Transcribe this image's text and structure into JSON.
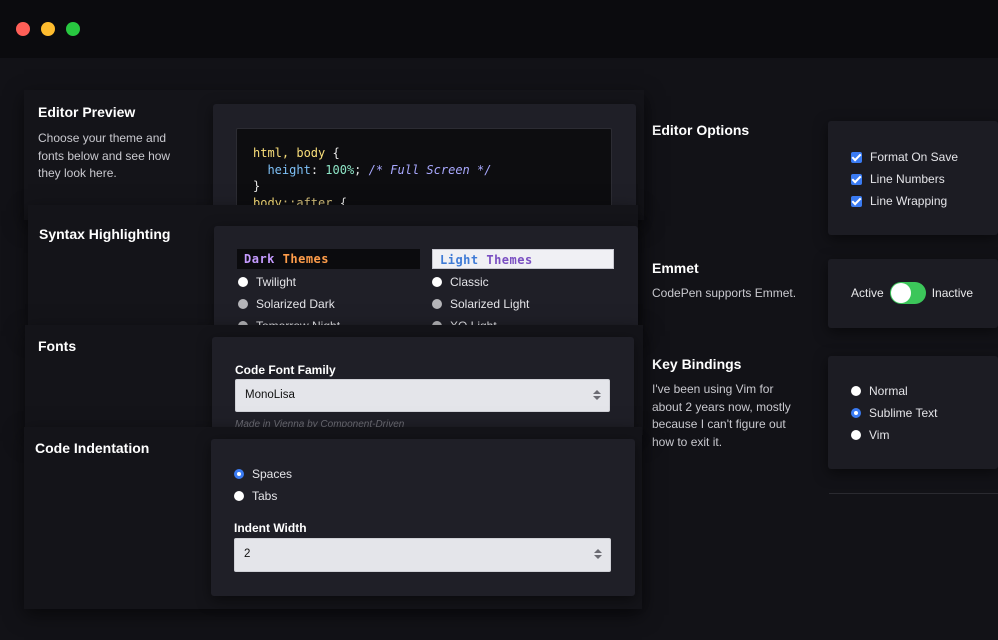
{
  "editor_preview": {
    "title": "Editor Preview",
    "description_lines": [
      "Choose your theme and",
      "fonts below and see how",
      "they look here."
    ],
    "code": {
      "line1_selector": "html, body",
      "line1_brace": " {",
      "line2_property": "height",
      "line2_colon": ": ",
      "line2_value": "100%",
      "line2_semicolon": "; ",
      "line2_comment": "/* Full Screen */",
      "line3": "}",
      "line4_selector": "body",
      "line4_pseudo": "::after",
      "line4_brace": " {"
    }
  },
  "syntax_highlighting": {
    "title": "Syntax Highlighting",
    "dark_header": [
      "Dark",
      "Themes"
    ],
    "light_header": [
      "Light",
      "Themes"
    ],
    "dark_themes": [
      "Twilight",
      "Solarized Dark",
      "Tomorrow Night"
    ],
    "light_themes": [
      "Classic",
      "Solarized Light",
      "XQ Light"
    ]
  },
  "fonts": {
    "title": "Fonts",
    "field_label": "Code Font Family",
    "selected_font": "MonoLisa",
    "hint": "Made in Vienna by Component-Driven"
  },
  "code_indentation": {
    "title": "Code Indentation",
    "options": [
      "Spaces",
      "Tabs"
    ],
    "selected": "Spaces",
    "width_label": "Indent Width",
    "width_value": "2"
  },
  "editor_options": {
    "title": "Editor Options",
    "checkboxes": [
      "Format On Save",
      "Line Numbers",
      "Line Wrapping"
    ]
  },
  "emmet": {
    "title": "Emmet",
    "description": "CodePen supports Emmet.",
    "toggle_on_label": "Active",
    "toggle_off_label": "Inactive"
  },
  "key_bindings": {
    "title": "Key Bindings",
    "description_lines": [
      "I've been using Vim for",
      "about 2 years now, mostly",
      "because I can't figure out",
      "how to exit it."
    ],
    "options": [
      "Normal",
      "Sublime Text",
      "Vim"
    ],
    "selected": "Sublime Text"
  },
  "colors": {
    "accent": "#3a7bf3",
    "toggle_green": "#3cc65a"
  }
}
